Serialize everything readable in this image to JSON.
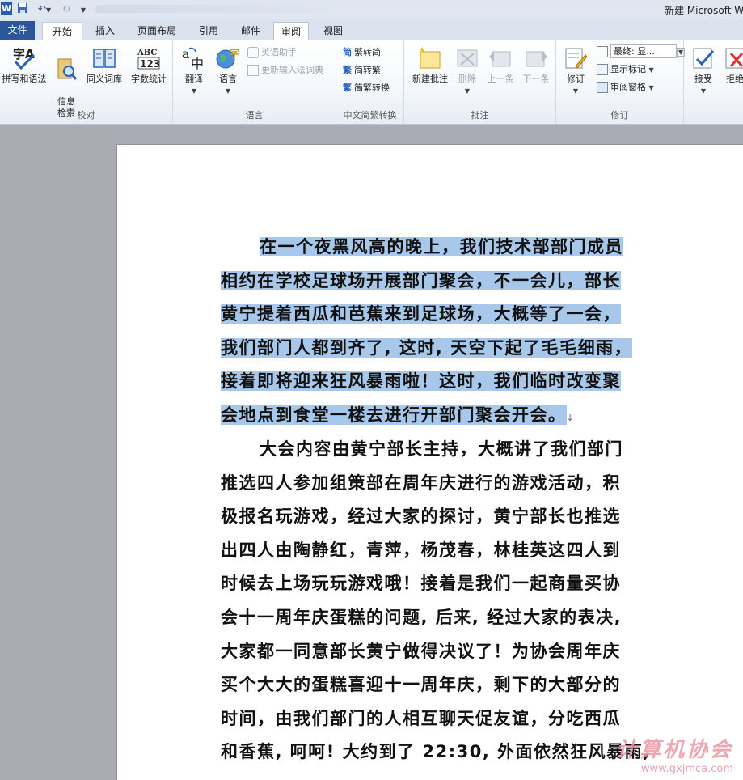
{
  "window": {
    "title": "新建 Microsoft W"
  },
  "tabs": {
    "file": "文件",
    "items": [
      "开始",
      "插入",
      "页面布局",
      "引用",
      "邮件",
      "审阅",
      "视图"
    ],
    "active_index": 5
  },
  "ribbon": {
    "proofing": {
      "label": "校对",
      "spelling": "拼写和语法",
      "research": "信息\n检索",
      "thesaurus": "同义词库",
      "wordcount": "字数统计"
    },
    "language": {
      "label": "语言",
      "translate": "翻译",
      "language": "语言",
      "english_assistant": "英语助手",
      "update_ime": "更新输入法词典"
    },
    "chinese": {
      "label": "中文简繁转换",
      "to_simplified": "繁转简",
      "to_traditional": "简转繁",
      "conversion": "简繁转换"
    },
    "comments": {
      "label": "批注",
      "new_comment": "新建批注",
      "delete": "删除",
      "previous": "上一条",
      "next": "下一条"
    },
    "tracking": {
      "label": "修订",
      "track_changes": "修订",
      "display_select": "最终: 显...",
      "show_markup": "显示标记",
      "reviewing_pane": "审阅窗格"
    },
    "changes": {
      "accept": "接受",
      "reject": "拒绝"
    }
  },
  "document": {
    "selected_lines": [
      "在一个夜黑风高的晚上，我们技术部部门成员",
      "相约在学校足球场开展部门聚会，不一会儿，部长",
      "黄宁提着西瓜和芭蕉来到足球场，大概等了一会，",
      "我们部门人都到齐了, 这时, 天空下起了毛毛细雨，",
      "接着即将迎来狂风暴雨啦！这时，我们临时改变聚",
      "会地点到食堂一楼去进行开部门聚会开会。"
    ],
    "body_lines": [
      "大会内容由黄宁部长主持，大概讲了我们部门",
      "推选四人参加组策部在周年庆进行的游戏活动，积",
      "极报名玩游戏，经过大家的探讨，黄宁部长也推选",
      "出四人由陶静红，青萍，杨茂春，林桂英这四人到",
      "时候去上场玩玩游戏哦！接着是我们一起商量买协",
      "会十一周年庆蛋糕的问题, 后来, 经过大家的表决,",
      "大家都一同意部长黄宁做得决议了！为协会周年庆",
      "买个大大的蛋糕喜迎十一周年庆，剩下的大部分的",
      "时间，由我们部门的人相互聊天促友谊，分吃西瓜",
      "和香蕉, 呵呵! 大约到了 22:30, 外面依然狂风暴雨,"
    ],
    "para_mark": "↓"
  },
  "watermark": {
    "title": "计算机协会",
    "url": "www.gxjmca.com"
  }
}
